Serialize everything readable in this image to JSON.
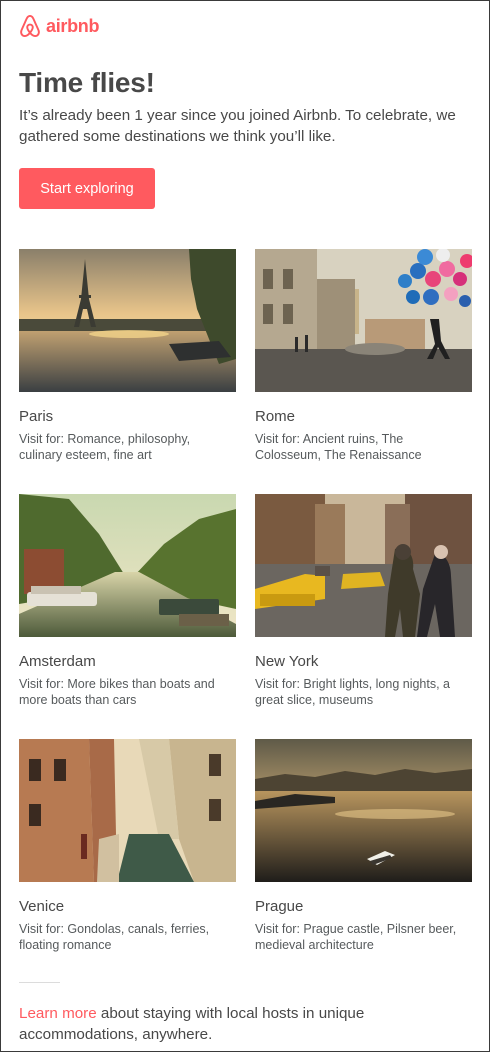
{
  "brand": {
    "name": "airbnb",
    "logo_icon": "airbnb-belo-icon",
    "color": "#FF5A5F"
  },
  "headline": "Time flies!",
  "intro": "It’s already been 1 year since you joined Airbnb. To celebrate, we gathered some destinations we think you’ll like.",
  "cta": {
    "label": "Start exploring",
    "color": "#FF5A5F"
  },
  "destinations": [
    {
      "city": "Paris",
      "visit": "Visit for: Romance, philosophy, culinary esteem, fine art",
      "image": "paris-eiffel-tower-sunset-photo"
    },
    {
      "city": "Rome",
      "visit": "Visit for: Ancient ruins, The Colosseum, The Renaissance",
      "image": "rome-piazza-balloons-photo"
    },
    {
      "city": "Amsterdam",
      "visit": "Visit for: More bikes than boats and more boats than cars",
      "image": "amsterdam-canal-photo"
    },
    {
      "city": "New York",
      "visit": "Visit for: Bright lights, long nights, a great slice, museums",
      "image": "new-york-street-taxi-photo"
    },
    {
      "city": "Venice",
      "visit": "Visit for: Gondolas, canals, ferries, floating romance",
      "image": "venice-narrow-canal-photo"
    },
    {
      "city": "Prague",
      "visit": "Visit for: Prague castle, Pilsner beer, medieval architecture",
      "image": "prague-river-sunset-photo"
    }
  ],
  "footer": {
    "link_label": "Learn more",
    "text": " about staying with local hosts in unique accommodations, anywhere."
  }
}
